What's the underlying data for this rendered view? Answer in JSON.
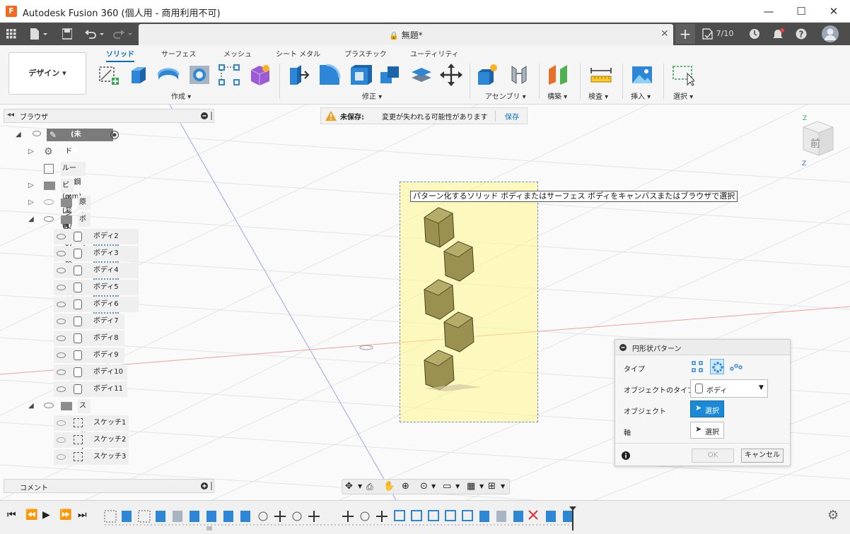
{
  "window": {
    "title": "Autodesk Fusion 360 (個人用 - 商用利用不可)",
    "logo_letter": "F",
    "minimize": "—",
    "maximize": "☐",
    "close": "✕"
  },
  "quickbar": {
    "job_status": "7/10"
  },
  "document_tab": {
    "title": "無題*",
    "lock_icon": "🔒",
    "close": "✕",
    "new_tab": "+"
  },
  "ribbon": {
    "workspace": "デザイン ▾",
    "tabs": [
      "ソリッド",
      "サーフェス",
      "メッシュ",
      "シート メタル",
      "プラスチック",
      "ユーティリティ"
    ],
    "groups": [
      "作成 ▾",
      "修正 ▾",
      "アセンブリ ▾",
      "構築 ▾",
      "検査 ▾",
      "挿入 ▾",
      "選択 ▾"
    ]
  },
  "browser": {
    "title": "ブラウザ",
    "root": "(未保存)",
    "items": [
      {
        "label": "ドキュメントの設定"
      },
      {
        "label": "ルール: 鋼(mm) (変換)"
      },
      {
        "label": "ビュー管理"
      },
      {
        "label": "原点"
      },
      {
        "label": "ボディ"
      }
    ],
    "bodies": [
      "ボディ2",
      "ボディ3",
      "ボディ4",
      "ボディ5",
      "ボディ6",
      "ボディ7",
      "ボディ8",
      "ボディ9",
      "ボディ10",
      "ボディ11"
    ],
    "sketch_folder": "スケッチ",
    "sketches": [
      "スケッチ1",
      "スケッチ2",
      "スケッチ3"
    ]
  },
  "warning": {
    "label": "未保存:",
    "message": "変更が失われる可能性があります",
    "save": "保存"
  },
  "viewport": {
    "tooltip": "パターン化するソリッド ボディまたはサーフェス ボディをキャンバスまたはブラウザで選択",
    "viewcube_face": "前",
    "axis_z": "Z",
    "axis_z_bottom": "Z"
  },
  "pattern_panel": {
    "title": "円形状パターン",
    "type_label": "タイプ",
    "object_type_label": "オブジェクトのタイプ",
    "object_type_value": "ボディ",
    "object_label": "オブジェクト",
    "object_button": "選択",
    "axis_label": "軸",
    "axis_button": "選択",
    "ok": "OK",
    "cancel": "キャンセル"
  },
  "comments": {
    "title": "コメント"
  },
  "colors": {
    "accent": "#0a6ebd",
    "selection_fill": "#fff58c",
    "body_fill": "#9a9150",
    "quickbar": "#4d4d4d"
  }
}
